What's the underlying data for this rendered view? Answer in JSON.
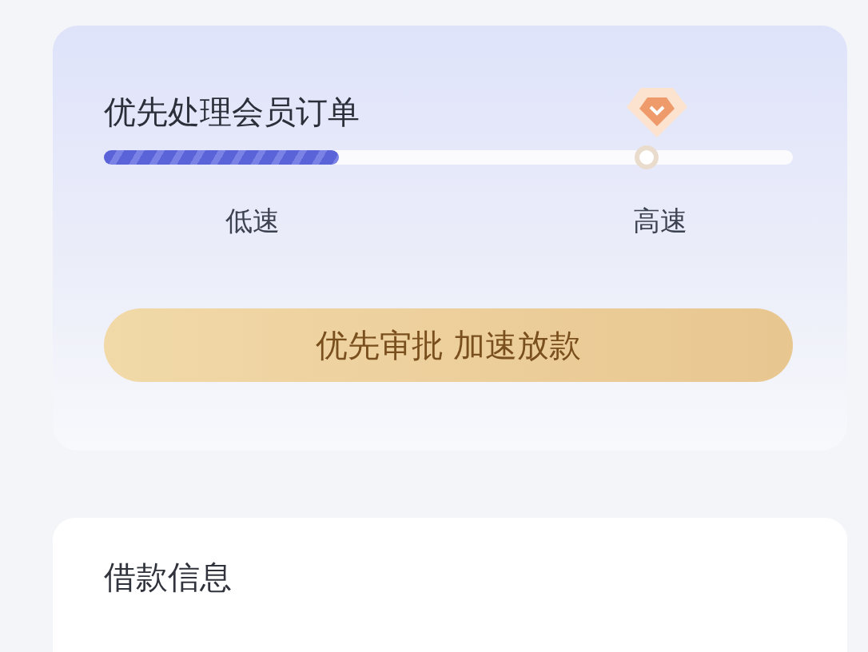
{
  "member_card": {
    "title": "优先处理会员订单",
    "speed": {
      "level": 0.34,
      "labels": [
        "低速",
        "高速"
      ]
    },
    "button": "优先审批  加速放款"
  },
  "loan_card": {
    "title": "借款信息"
  }
}
